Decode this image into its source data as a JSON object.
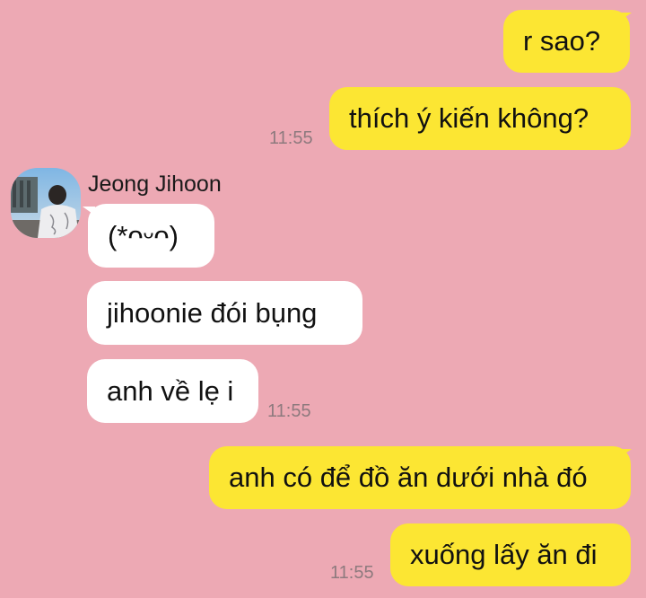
{
  "messages": {
    "m1": {
      "text": "r sao?"
    },
    "m2": {
      "text": "thích ý kiến không?",
      "time": "11:55"
    },
    "contact": {
      "name": "Jeong Jihoon",
      "avatar": "profile-photo"
    },
    "m3": {
      "text": "(*ᴖᵕᴖ)"
    },
    "m4": {
      "text": "jihoonie đói bụng"
    },
    "m5": {
      "text": "anh về lẹ i",
      "time": "11:55"
    },
    "m6": {
      "text": "anh có để đồ ăn dưới nhà đó"
    },
    "m7": {
      "text": "xuống lấy ăn đi",
      "time": "11:55"
    }
  },
  "colors": {
    "background": "#EDA9B4",
    "outgoing_bubble": "#FCE633",
    "incoming_bubble": "#FFFFFF",
    "timestamp": "#8E7A7E"
  }
}
